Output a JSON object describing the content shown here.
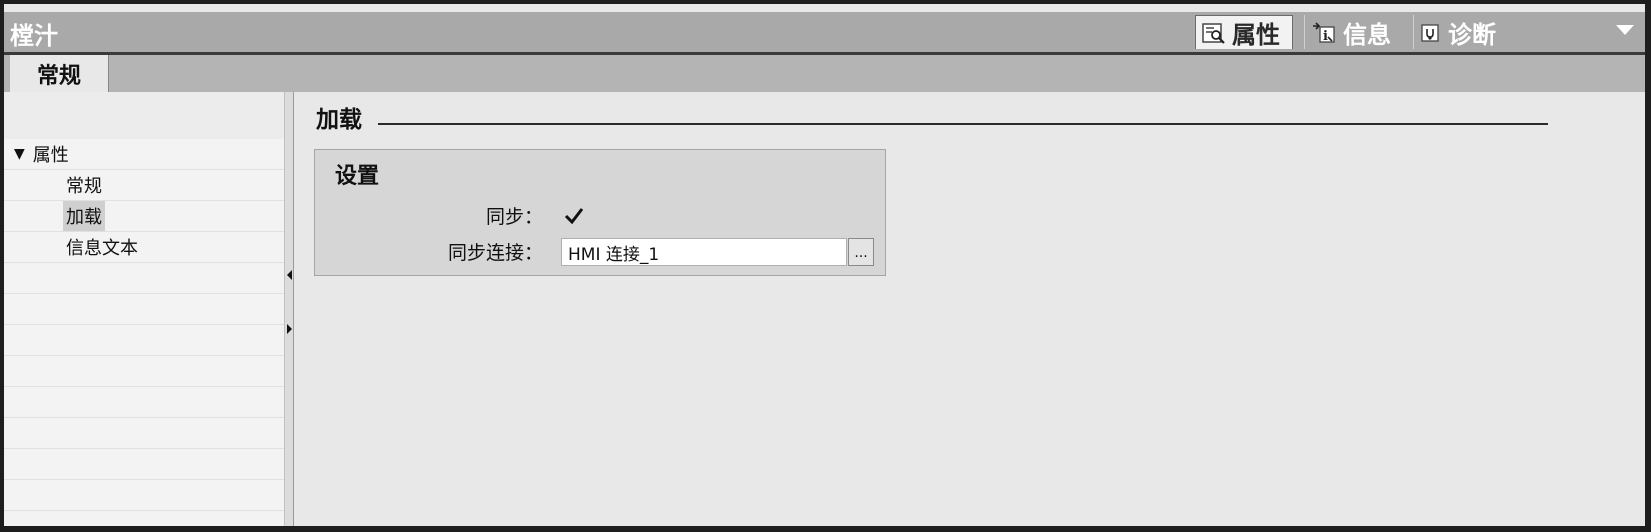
{
  "window": {
    "title": "樘汁",
    "tabs": [
      {
        "label": "属性",
        "icon": "properties-icon",
        "active": true
      },
      {
        "label": "信息",
        "icon": "info-icon",
        "active": false
      },
      {
        "label": "诊断",
        "icon": "diagnostics-icon",
        "active": false
      }
    ],
    "menu_icon": "chevron-down-icon"
  },
  "section_tabs": [
    {
      "label": "常规",
      "active": true
    }
  ],
  "nav": {
    "group": {
      "label": "属性",
      "expanded": true
    },
    "items": [
      {
        "label": "常规",
        "selected": false
      },
      {
        "label": "加载",
        "selected": true
      },
      {
        "label": "信息文本",
        "selected": false
      }
    ]
  },
  "content": {
    "section_title": "加载",
    "settings": {
      "title": "设置",
      "sync_label": "同步：",
      "sync_checked": true,
      "sync_connection_label": "同步连接：",
      "sync_connection_value": "HMI 连接_1",
      "browse_label": "..."
    }
  }
}
